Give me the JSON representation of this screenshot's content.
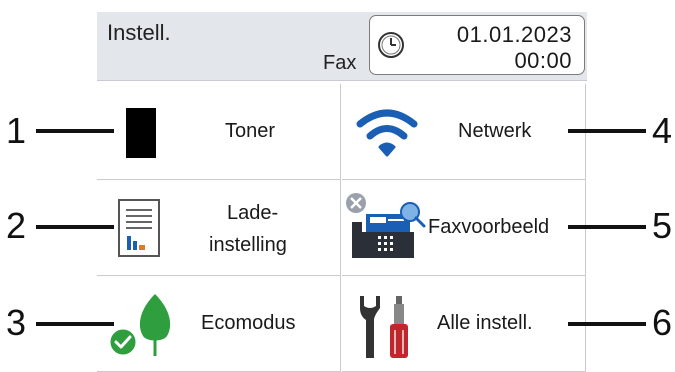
{
  "header": {
    "title": "Instell.",
    "mode": "Fax",
    "date": "01.01.2023",
    "time": "00:00"
  },
  "tiles": [
    {
      "label": "Toner",
      "icon": "toner-icon"
    },
    {
      "label": "Netwerk",
      "icon": "wifi-icon"
    },
    {
      "label": "Lade-",
      "label2": "instelling",
      "icon": "tray-settings-icon"
    },
    {
      "label": "Faxvoorbeeld",
      "icon": "fax-preview-icon"
    },
    {
      "label": "Ecomodus",
      "icon": "leaf-icon"
    },
    {
      "label": "Alle instell.",
      "icon": "tools-icon"
    }
  ],
  "callouts": [
    "1",
    "2",
    "3",
    "4",
    "5",
    "6"
  ],
  "colors": {
    "header_bg": "#e3e6ea",
    "wifi_blue": "#1a5fb4",
    "eco_green": "#2e9e3e",
    "tool_red": "#c0272d",
    "grid_line": "#c8ccd2"
  }
}
